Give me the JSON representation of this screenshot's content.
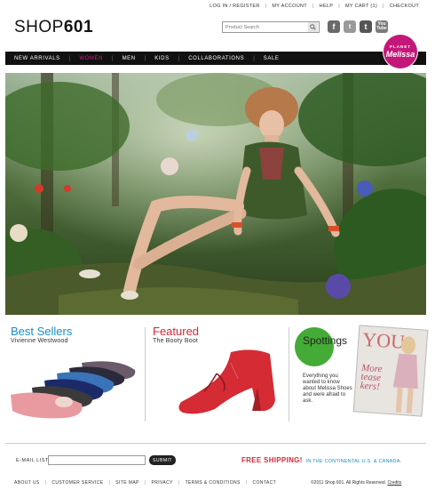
{
  "util_links": [
    "LOG IN / REGISTER",
    "MY ACCOUNT",
    "HELP",
    "MY CART (1)",
    "CHECKOUT"
  ],
  "logo": {
    "thin": "SHOP",
    "bold": "601"
  },
  "search": {
    "placeholder": "Product Search"
  },
  "social": {
    "facebook": "f",
    "twitter": "t",
    "tumblr": "t",
    "youtube_top": "You",
    "youtube_bottom": "Tube"
  },
  "badge": {
    "line1": "PLANET",
    "line2": "Melissa"
  },
  "nav": [
    "NEW ARRIVALS",
    "WOMEN",
    "MEN",
    "KIDS",
    "COLLABORATIONS",
    "SALE"
  ],
  "nav_active": "WOMEN",
  "panels": {
    "best": {
      "title": "Best Sellers",
      "sub": "Vivienne Westwood"
    },
    "featured": {
      "title": "Featured",
      "sub": "The Booty Boot"
    },
    "spottings": {
      "title": "Spottings",
      "desc": "Everything you wanted to know about Melissa Shoes and were afraid to ask."
    },
    "magazine": {
      "masthead": "YOU",
      "cover_line1": "More",
      "cover_line2": "tease",
      "cover_line3": "kers!"
    }
  },
  "footer": {
    "email_label": "E-MAIL LIST",
    "submit": "SUBMIT",
    "shipping_strong": "FREE SHIPPING!",
    "shipping_rest": "IN THE CONTINENTAL U.S. & CANADA.",
    "links": [
      "ABOUT US",
      "CUSTOMER SERVICE",
      "SITE MAP",
      "PRIVACY",
      "TERMS & CONDITIONS",
      "CONTACT"
    ],
    "copyright": "©2011 Shop 601. All Rights Reserved.",
    "credits": "Credits"
  },
  "colors": {
    "accent_pink": "#d41c83",
    "blue": "#1a8fc9",
    "red": "#d42b35",
    "green": "#44ab36",
    "badge": "#c4177a"
  }
}
